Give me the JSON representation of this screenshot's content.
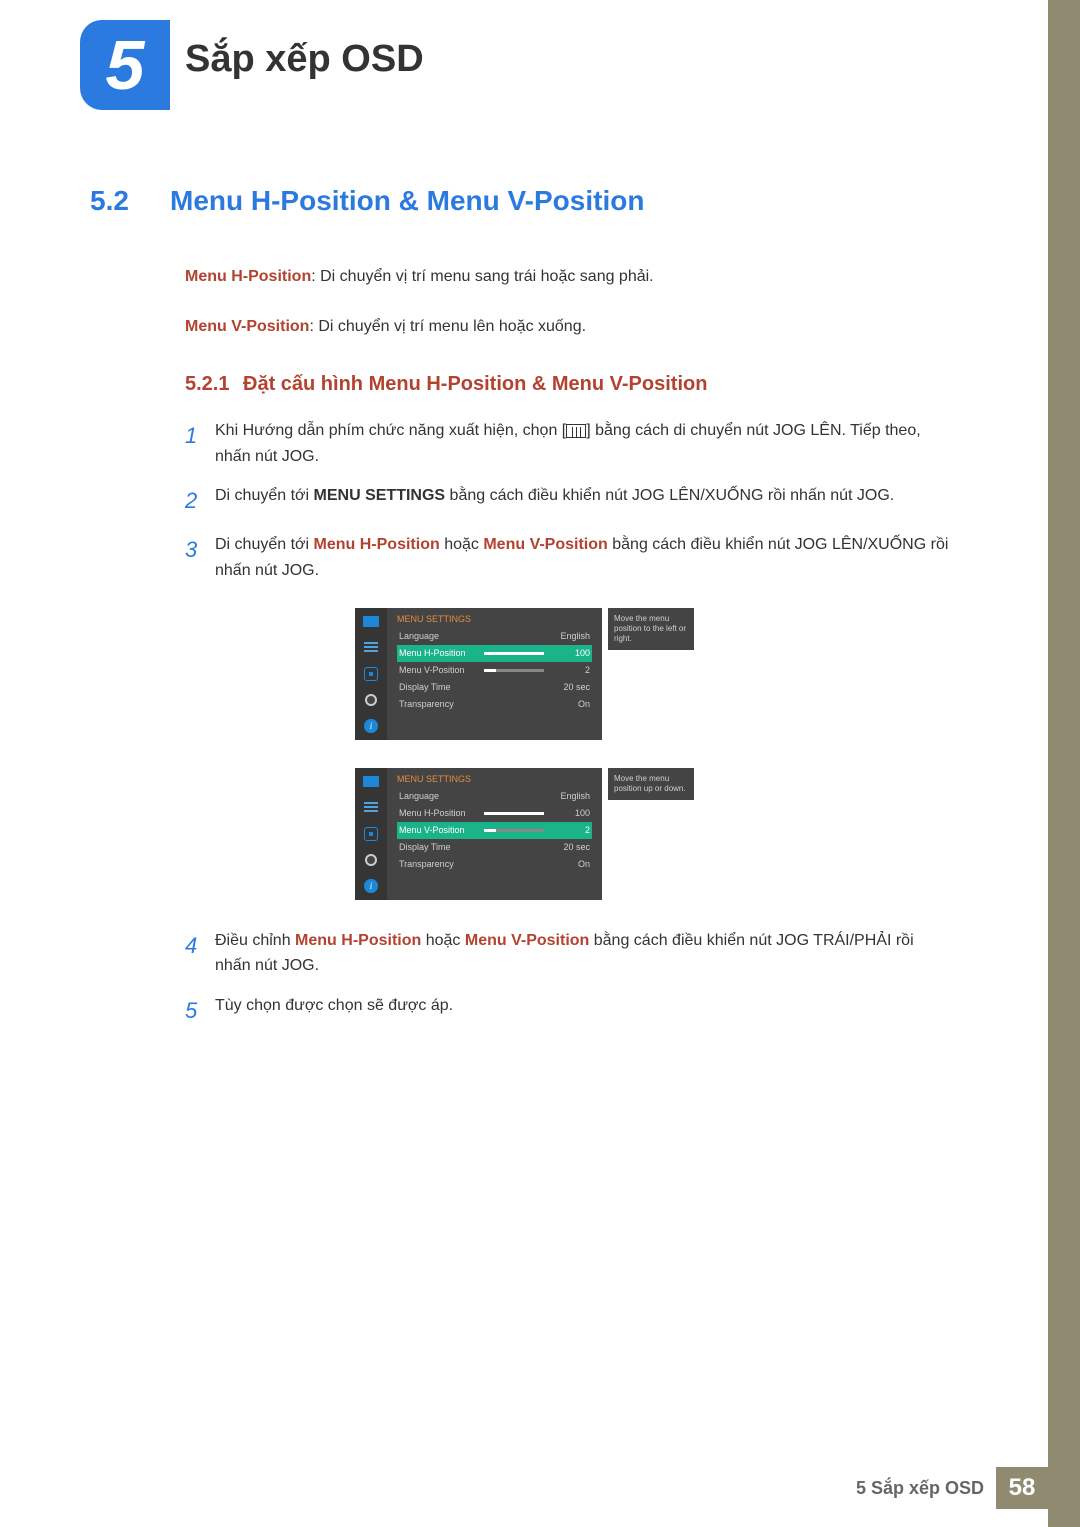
{
  "chapter": {
    "num": "5",
    "title": "Sắp xếp OSD"
  },
  "section": {
    "num": "5.2",
    "title": "Menu H-Position & Menu V-Position"
  },
  "desc": {
    "h_label": "Menu H-Position",
    "h_text": ": Di chuyển vị trí menu sang trái hoặc sang phải.",
    "v_label": "Menu V-Position",
    "v_text": ": Di chuyển vị trí menu lên hoặc xuống."
  },
  "subsection": {
    "num": "5.2.1",
    "title": "Đặt cấu hình Menu H-Position & Menu V-Position"
  },
  "steps": {
    "s1n": "1",
    "s1a": "Khi Hướng dẫn phím chức năng xuất hiện, chọn [",
    "s1b": "] bằng cách di chuyển nút JOG LÊN. Tiếp theo, nhấn nút JOG.",
    "s2n": "2",
    "s2a": "Di chuyển tới ",
    "s2_bold": "MENU SETTINGS",
    "s2b": " bằng cách điều khiển nút JOG LÊN/XUỐNG rồi nhấn nút JOG.",
    "s3n": "3",
    "s3a": "Di chuyển tới ",
    "s3_r1": "Menu H-Position",
    "s3b": " hoặc ",
    "s3_r2": "Menu V-Position",
    "s3c": " bằng cách điều khiển nút JOG LÊN/XUỐNG rồi nhấn nút JOG.",
    "s4n": "4",
    "s4a": "Điều chỉnh ",
    "s4_r1": "Menu H-Position",
    "s4b": " hoặc ",
    "s4_r2": "Menu V-Position",
    "s4c": " bằng cách điều khiển nút JOG TRÁI/PHẢI rồi nhấn nút JOG.",
    "s5n": "5",
    "s5a": "Tùy chọn được chọn sẽ được áp."
  },
  "osd": {
    "title": "MENU SETTINGS",
    "rows": {
      "language": {
        "label": "Language",
        "value": "English"
      },
      "hpos": {
        "label": "Menu H-Position",
        "value": "100"
      },
      "vpos": {
        "label": "Menu V-Position",
        "value": "2"
      },
      "dtime": {
        "label": "Display Time",
        "value": "20 sec"
      },
      "transp": {
        "label": "Transparency",
        "value": "On"
      }
    },
    "tip1": "Move the menu position to the left or right.",
    "tip2": "Move the menu position up or down.",
    "info_glyph": "i"
  },
  "footer": {
    "label": "5 Sắp xếp OSD",
    "page": "58"
  }
}
